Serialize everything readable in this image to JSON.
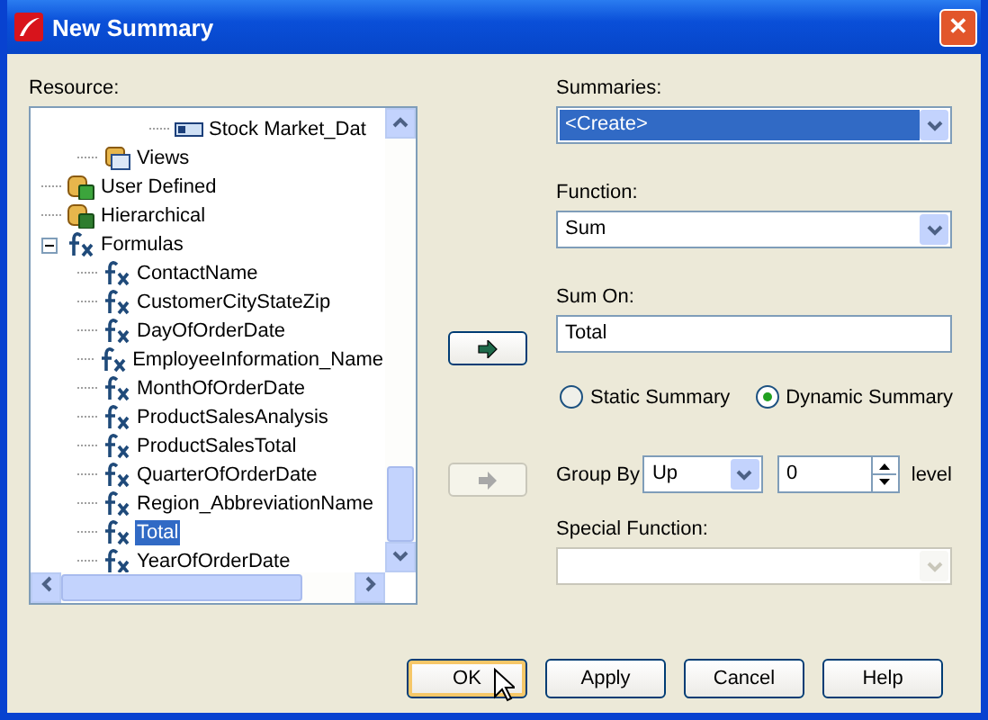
{
  "window": {
    "title": "New Summary",
    "close": "✕"
  },
  "resource": {
    "label": "Resource:",
    "tree": [
      {
        "children": [
          {
            "children": [
              {
                "children": [
                  {
                    "label": "Stock Market_Dat",
                    "kind": "table",
                    "selected": false
                  }
                ]
              }
            ]
          },
          {
            "label": "Views",
            "kind": "views",
            "selected": false
          }
        ]
      },
      {
        "label": "User Defined",
        "kind": "userdef",
        "selected": false
      },
      {
        "label": "Hierarchical",
        "kind": "hier",
        "selected": false
      },
      {
        "label": "Formulas",
        "kind": "formula",
        "selected": false,
        "expanded": true,
        "children": [
          {
            "label": "ContactName",
            "kind": "formula",
            "selected": false
          },
          {
            "label": "CustomerCityStateZip",
            "kind": "formula",
            "selected": false
          },
          {
            "label": "DayOfOrderDate",
            "kind": "formula",
            "selected": false
          },
          {
            "label": "EmployeeInformation_Name",
            "kind": "formula",
            "selected": false
          },
          {
            "label": "MonthOfOrderDate",
            "kind": "formula",
            "selected": false
          },
          {
            "label": "ProductSalesAnalysis",
            "kind": "formula",
            "selected": false
          },
          {
            "label": "ProductSalesTotal",
            "kind": "formula",
            "selected": false
          },
          {
            "label": "QuarterOfOrderDate",
            "kind": "formula",
            "selected": false
          },
          {
            "label": "Region_AbbreviationName",
            "kind": "formula",
            "selected": false
          },
          {
            "label": "Total",
            "kind": "formula",
            "selected": true
          },
          {
            "label": "YearOfOrderDate",
            "kind": "formula",
            "selected": false
          }
        ]
      }
    ]
  },
  "summaries": {
    "label": "Summaries:",
    "value": "<Create>"
  },
  "function": {
    "label": "Function:",
    "value": "Sum"
  },
  "sum_on": {
    "label": "Sum On:",
    "value": "Total",
    "add_disabled": false
  },
  "radios": [
    {
      "label": "Static Summary",
      "selected": false
    },
    {
      "label": "Dynamic Summary",
      "selected": true
    }
  ],
  "group_by": {
    "label": "Group By",
    "value": "Up",
    "count": "0",
    "unit": "level",
    "add_disabled": true
  },
  "special_function": {
    "label": "Special Function:",
    "disabled": true
  },
  "buttons": [
    {
      "label": "OK",
      "default": true
    },
    {
      "label": "Apply",
      "default": false
    },
    {
      "label": "Cancel",
      "default": false
    },
    {
      "label": "Help",
      "default": false
    }
  ]
}
